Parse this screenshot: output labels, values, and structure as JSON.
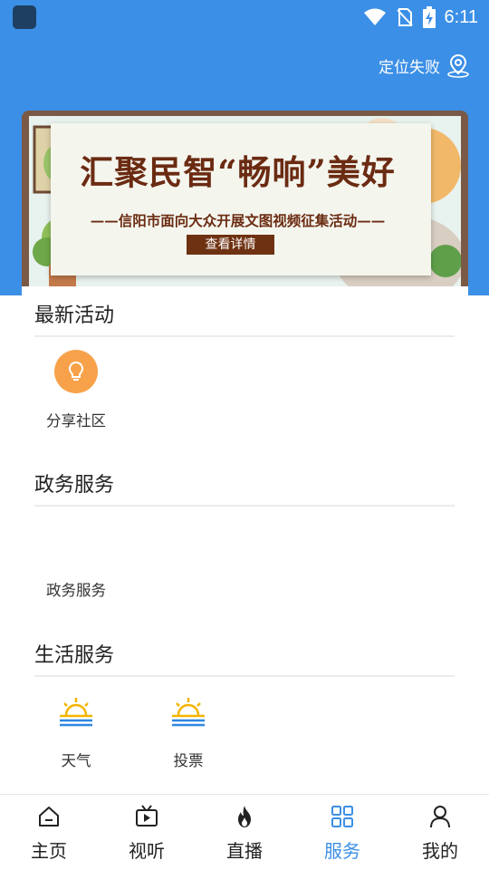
{
  "status_bar": {
    "time": "6:11"
  },
  "header": {
    "location_text": "定位失败"
  },
  "banner": {
    "title": "汇聚民智“畅响”美好",
    "subtitle": "——信阳市面向大众开展文图视频征集活动——",
    "button_label": "查看详情"
  },
  "sections": {
    "latest": {
      "title": "最新活动",
      "items": [
        {
          "label": "分享社区",
          "icon": "lightbulb-icon"
        }
      ]
    },
    "gov": {
      "title": "政务服务",
      "items": [
        {
          "label": "政务服务"
        }
      ]
    },
    "life": {
      "title": "生活服务",
      "items": [
        {
          "label": "天气",
          "icon": "sunrise-icon"
        },
        {
          "label": "投票",
          "icon": "sunrise-icon"
        }
      ]
    }
  },
  "bottom_nav": [
    {
      "label": "主页",
      "icon": "home-icon"
    },
    {
      "label": "视听",
      "icon": "tv-play-icon"
    },
    {
      "label": "直播",
      "icon": "flame-icon"
    },
    {
      "label": "服务",
      "icon": "grid-icon",
      "active": true
    },
    {
      "label": "我的",
      "icon": "user-icon"
    }
  ],
  "colors": {
    "primary": "#3b8fe6",
    "accent_orange": "#f7a24a",
    "banner_text": "#6b2b12"
  }
}
